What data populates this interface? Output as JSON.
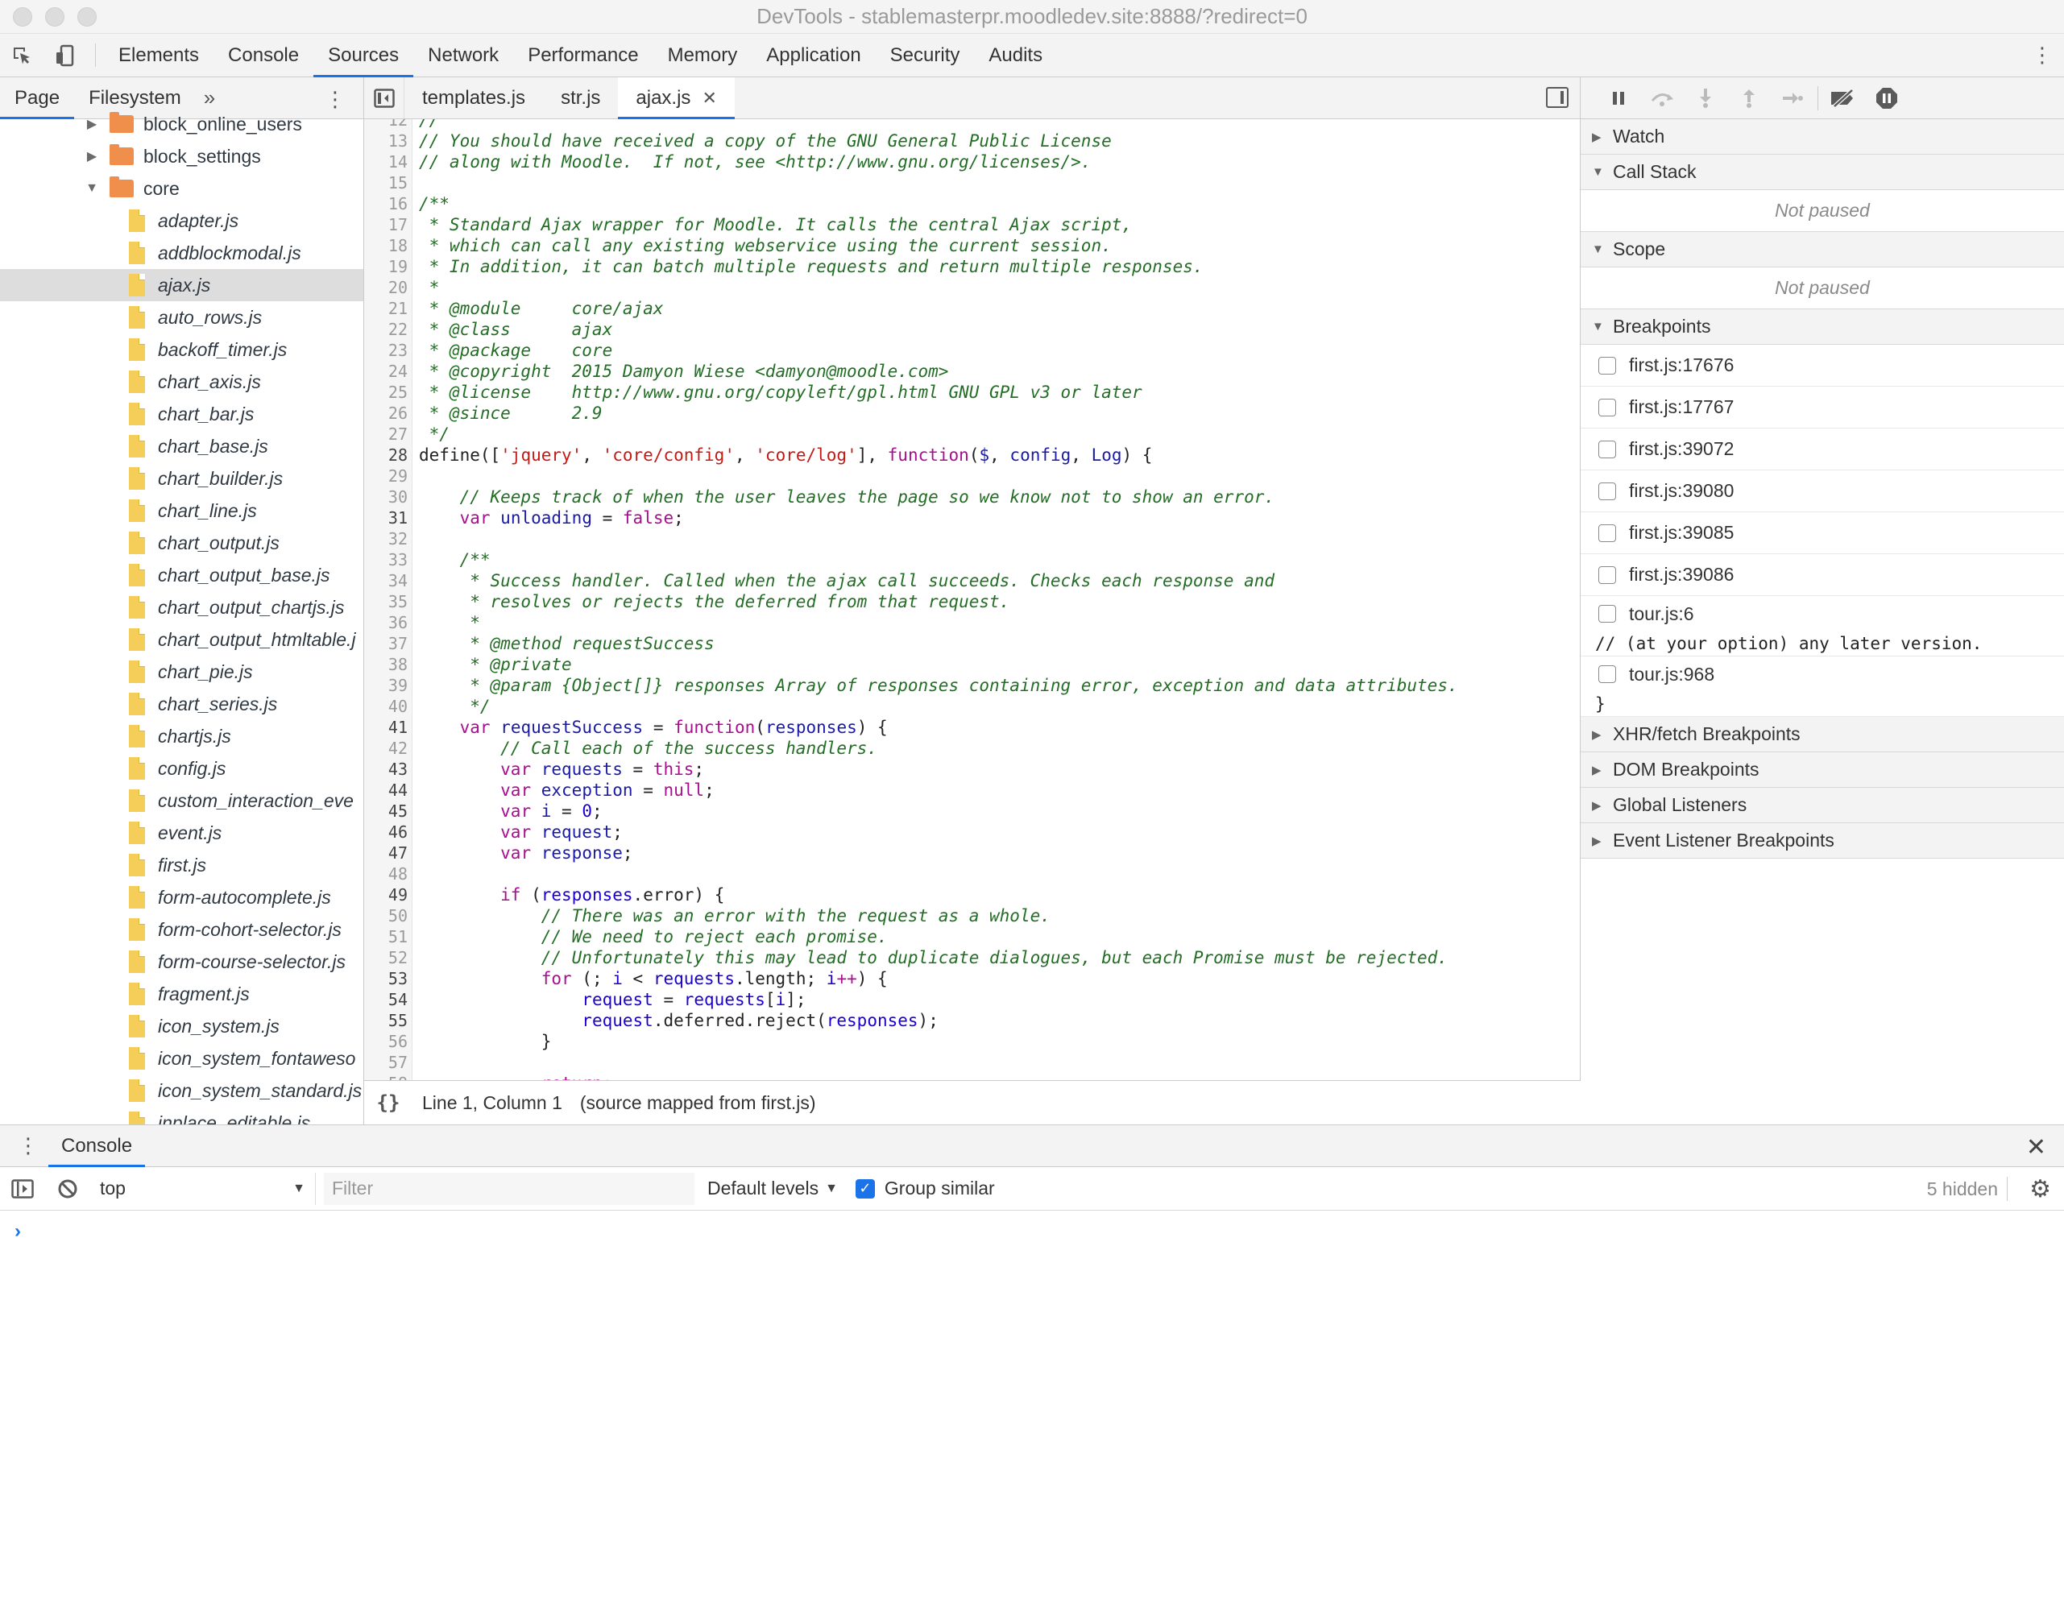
{
  "window": {
    "title": "DevTools - stablemasterpr.moodledev.site:8888/?redirect=0"
  },
  "main_tabs": [
    {
      "label": "Elements"
    },
    {
      "label": "Console"
    },
    {
      "label": "Sources"
    },
    {
      "label": "Network"
    },
    {
      "label": "Performance"
    },
    {
      "label": "Memory"
    },
    {
      "label": "Application"
    },
    {
      "label": "Security"
    },
    {
      "label": "Audits"
    }
  ],
  "active_main_tab": "Sources",
  "navigator": {
    "tabs": [
      {
        "label": "Page"
      },
      {
        "label": "Filesystem"
      }
    ],
    "more": "»",
    "tree": [
      {
        "label": "block_online_users",
        "type": "folder",
        "state": "collapsed",
        "level": 1
      },
      {
        "label": "block_settings",
        "type": "folder",
        "state": "collapsed",
        "level": 1
      },
      {
        "label": "core",
        "type": "folder",
        "state": "expanded",
        "level": 1
      },
      {
        "label": "adapter.js",
        "type": "file",
        "level": 2
      },
      {
        "label": "addblockmodal.js",
        "type": "file",
        "level": 2
      },
      {
        "label": "ajax.js",
        "type": "file",
        "level": 2,
        "selected": true
      },
      {
        "label": "auto_rows.js",
        "type": "file",
        "level": 2
      },
      {
        "label": "backoff_timer.js",
        "type": "file",
        "level": 2
      },
      {
        "label": "chart_axis.js",
        "type": "file",
        "level": 2
      },
      {
        "label": "chart_bar.js",
        "type": "file",
        "level": 2
      },
      {
        "label": "chart_base.js",
        "type": "file",
        "level": 2
      },
      {
        "label": "chart_builder.js",
        "type": "file",
        "level": 2
      },
      {
        "label": "chart_line.js",
        "type": "file",
        "level": 2
      },
      {
        "label": "chart_output.js",
        "type": "file",
        "level": 2
      },
      {
        "label": "chart_output_base.js",
        "type": "file",
        "level": 2
      },
      {
        "label": "chart_output_chartjs.js",
        "type": "file",
        "level": 2
      },
      {
        "label": "chart_output_htmltable.j",
        "type": "file",
        "level": 2
      },
      {
        "label": "chart_pie.js",
        "type": "file",
        "level": 2
      },
      {
        "label": "chart_series.js",
        "type": "file",
        "level": 2
      },
      {
        "label": "chartjs.js",
        "type": "file",
        "level": 2
      },
      {
        "label": "config.js",
        "type": "file",
        "level": 2
      },
      {
        "label": "custom_interaction_eve",
        "type": "file",
        "level": 2
      },
      {
        "label": "event.js",
        "type": "file",
        "level": 2
      },
      {
        "label": "first.js",
        "type": "file",
        "level": 2
      },
      {
        "label": "form-autocomplete.js",
        "type": "file",
        "level": 2
      },
      {
        "label": "form-cohort-selector.js",
        "type": "file",
        "level": 2
      },
      {
        "label": "form-course-selector.js",
        "type": "file",
        "level": 2
      },
      {
        "label": "fragment.js",
        "type": "file",
        "level": 2
      },
      {
        "label": "icon_system.js",
        "type": "file",
        "level": 2
      },
      {
        "label": "icon_system_fontaweso",
        "type": "file",
        "level": 2
      },
      {
        "label": "icon_system_standard.js",
        "type": "file",
        "level": 2
      },
      {
        "label": "inplace_editable.js",
        "type": "file",
        "level": 2
      }
    ]
  },
  "editor": {
    "tabs": [
      {
        "label": "templates.js",
        "active": false
      },
      {
        "label": "str.js",
        "active": false
      },
      {
        "label": "ajax.js",
        "active": true,
        "closable": true
      }
    ],
    "lines": [
      {
        "n": "12",
        "t": [
          [
            "c-comment",
            "//"
          ]
        ]
      },
      {
        "n": "13",
        "t": [
          [
            "c-comment",
            "// You should have received a copy of the GNU General Public License"
          ]
        ]
      },
      {
        "n": "14",
        "t": [
          [
            "c-comment",
            "// along with Moodle.  If not, see <http://www.gnu.org/licenses/>."
          ]
        ]
      },
      {
        "n": "15",
        "t": []
      },
      {
        "n": "16",
        "t": [
          [
            "c-comment",
            "/**"
          ]
        ]
      },
      {
        "n": "17",
        "t": [
          [
            "c-comment",
            " * Standard Ajax wrapper for Moodle. It calls the central Ajax script,"
          ]
        ]
      },
      {
        "n": "18",
        "t": [
          [
            "c-comment",
            " * which can call any existing webservice using the current session."
          ]
        ]
      },
      {
        "n": "19",
        "t": [
          [
            "c-comment",
            " * In addition, it can batch multiple requests and return multiple responses."
          ]
        ]
      },
      {
        "n": "20",
        "t": [
          [
            "c-comment",
            " *"
          ]
        ]
      },
      {
        "n": "21",
        "t": [
          [
            "c-comment",
            " * @module     core/ajax"
          ]
        ]
      },
      {
        "n": "22",
        "t": [
          [
            "c-comment",
            " * @class      ajax"
          ]
        ]
      },
      {
        "n": "23",
        "t": [
          [
            "c-comment",
            " * @package    core"
          ]
        ]
      },
      {
        "n": "24",
        "t": [
          [
            "c-comment",
            " * @copyright  2015 Damyon Wiese <damyon@moodle.com>"
          ]
        ]
      },
      {
        "n": "25",
        "t": [
          [
            "c-comment",
            " * @license    http://www.gnu.org/copyleft/gpl.html GNU GPL v3 or later"
          ]
        ]
      },
      {
        "n": "26",
        "t": [
          [
            "c-comment",
            " * @since      2.9"
          ]
        ]
      },
      {
        "n": "27",
        "t": [
          [
            "c-comment",
            " */"
          ]
        ]
      },
      {
        "n": "28",
        "bp": true,
        "t": [
          [
            "",
            "define(["
          ],
          [
            "c-str",
            "'jquery'"
          ],
          [
            "",
            ", "
          ],
          [
            "c-str",
            "'core/config'"
          ],
          [
            "",
            ", "
          ],
          [
            "c-str",
            "'core/log'"
          ],
          [
            "",
            "], "
          ],
          [
            "c-kw",
            "function"
          ],
          [
            "",
            "("
          ],
          [
            "c-def",
            "$"
          ],
          [
            "",
            ", "
          ],
          [
            "c-def",
            "config"
          ],
          [
            "",
            ", "
          ],
          [
            "c-def",
            "Log"
          ],
          [
            "",
            ") {"
          ]
        ]
      },
      {
        "n": "29",
        "t": []
      },
      {
        "n": "30",
        "t": [
          [
            "",
            "    "
          ],
          [
            "c-comment",
            "// Keeps track of when the user leaves the page so we know not to show an error."
          ]
        ]
      },
      {
        "n": "31",
        "bp": true,
        "t": [
          [
            "",
            "    "
          ],
          [
            "c-kw",
            "var"
          ],
          [
            "",
            " "
          ],
          [
            "c-def",
            "unloading"
          ],
          [
            "",
            " = "
          ],
          [
            "c-kw",
            "false"
          ],
          [
            "",
            ";"
          ]
        ]
      },
      {
        "n": "32",
        "t": []
      },
      {
        "n": "33",
        "t": [
          [
            "",
            "    "
          ],
          [
            "c-comment",
            "/**"
          ]
        ]
      },
      {
        "n": "34",
        "t": [
          [
            "",
            "    "
          ],
          [
            "c-comment",
            " * Success handler. Called when the ajax call succeeds. Checks each response and"
          ]
        ]
      },
      {
        "n": "35",
        "t": [
          [
            "",
            "    "
          ],
          [
            "c-comment",
            " * resolves or rejects the deferred from that request."
          ]
        ]
      },
      {
        "n": "36",
        "t": [
          [
            "",
            "    "
          ],
          [
            "c-comment",
            " *"
          ]
        ]
      },
      {
        "n": "37",
        "t": [
          [
            "",
            "    "
          ],
          [
            "c-comment",
            " * @method requestSuccess"
          ]
        ]
      },
      {
        "n": "38",
        "t": [
          [
            "",
            "    "
          ],
          [
            "c-comment",
            " * @private"
          ]
        ]
      },
      {
        "n": "39",
        "t": [
          [
            "",
            "    "
          ],
          [
            "c-comment",
            " * @param {Object[]} responses Array of responses containing error, exception and data attributes."
          ]
        ]
      },
      {
        "n": "40",
        "t": [
          [
            "",
            "    "
          ],
          [
            "c-comment",
            " */"
          ]
        ]
      },
      {
        "n": "41",
        "bp": true,
        "t": [
          [
            "",
            "    "
          ],
          [
            "c-kw",
            "var"
          ],
          [
            "",
            " "
          ],
          [
            "c-def",
            "requestSuccess"
          ],
          [
            "",
            " = "
          ],
          [
            "c-kw",
            "function"
          ],
          [
            "",
            "("
          ],
          [
            "c-def",
            "responses"
          ],
          [
            "",
            ") {"
          ]
        ]
      },
      {
        "n": "42",
        "t": [
          [
            "",
            "        "
          ],
          [
            "c-comment",
            "// Call each of the success handlers."
          ]
        ]
      },
      {
        "n": "43",
        "bp": true,
        "t": [
          [
            "",
            "        "
          ],
          [
            "c-kw",
            "var"
          ],
          [
            "",
            " "
          ],
          [
            "c-def",
            "requests"
          ],
          [
            "",
            " = "
          ],
          [
            "c-kw",
            "this"
          ],
          [
            "",
            ";"
          ]
        ]
      },
      {
        "n": "44",
        "bp": true,
        "t": [
          [
            "",
            "        "
          ],
          [
            "c-kw",
            "var"
          ],
          [
            "",
            " "
          ],
          [
            "c-def",
            "exception"
          ],
          [
            "",
            " = "
          ],
          [
            "c-kw",
            "null"
          ],
          [
            "",
            ";"
          ]
        ]
      },
      {
        "n": "45",
        "bp": true,
        "t": [
          [
            "",
            "        "
          ],
          [
            "c-kw",
            "var"
          ],
          [
            "",
            " "
          ],
          [
            "c-def",
            "i"
          ],
          [
            "",
            " = "
          ],
          [
            "c-num",
            "0"
          ],
          [
            "",
            ";"
          ]
        ]
      },
      {
        "n": "46",
        "bp": true,
        "t": [
          [
            "",
            "        "
          ],
          [
            "c-kw",
            "var"
          ],
          [
            "",
            " "
          ],
          [
            "c-def",
            "request"
          ],
          [
            "",
            ";"
          ]
        ]
      },
      {
        "n": "47",
        "bp": true,
        "t": [
          [
            "",
            "        "
          ],
          [
            "c-kw",
            "var"
          ],
          [
            "",
            " "
          ],
          [
            "c-def",
            "response"
          ],
          [
            "",
            ";"
          ]
        ]
      },
      {
        "n": "48",
        "t": []
      },
      {
        "n": "49",
        "bp": true,
        "t": [
          [
            "",
            "        "
          ],
          [
            "c-kw",
            "if"
          ],
          [
            "",
            " ("
          ],
          [
            "c-var",
            "responses"
          ],
          [
            "",
            ".error) {"
          ]
        ]
      },
      {
        "n": "50",
        "t": [
          [
            "",
            "            "
          ],
          [
            "c-comment",
            "// There was an error with the request as a whole."
          ]
        ]
      },
      {
        "n": "51",
        "t": [
          [
            "",
            "            "
          ],
          [
            "c-comment",
            "// We need to reject each promise."
          ]
        ]
      },
      {
        "n": "52",
        "t": [
          [
            "",
            "            "
          ],
          [
            "c-comment",
            "// Unfortunately this may lead to duplicate dialogues, but each Promise must be rejected."
          ]
        ]
      },
      {
        "n": "53",
        "bp": true,
        "t": [
          [
            "",
            "            "
          ],
          [
            "c-kw",
            "for"
          ],
          [
            "",
            " (; "
          ],
          [
            "c-var",
            "i"
          ],
          [
            "",
            " < "
          ],
          [
            "c-var",
            "requests"
          ],
          [
            "",
            ".length; "
          ],
          [
            "c-var",
            "i"
          ],
          [
            "c-kw",
            "++"
          ],
          [
            "",
            ") {"
          ]
        ]
      },
      {
        "n": "54",
        "bp": true,
        "t": [
          [
            "",
            "                "
          ],
          [
            "c-var",
            "request"
          ],
          [
            "",
            " = "
          ],
          [
            "c-var",
            "requests"
          ],
          [
            "",
            "["
          ],
          [
            "c-var",
            "i"
          ],
          [
            "",
            "];"
          ]
        ]
      },
      {
        "n": "55",
        "bp": true,
        "t": [
          [
            "",
            "                "
          ],
          [
            "c-var",
            "request"
          ],
          [
            "",
            ".deferred.reject("
          ],
          [
            "c-var",
            "responses"
          ],
          [
            "",
            ");"
          ]
        ]
      },
      {
        "n": "56",
        "t": [
          [
            "",
            "            }"
          ]
        ]
      },
      {
        "n": "57",
        "t": []
      },
      {
        "n": "58",
        "t": [
          [
            "",
            "            "
          ],
          [
            "c-kw",
            "return"
          ],
          [
            "",
            ";"
          ]
        ]
      }
    ],
    "status": {
      "braces": "{}",
      "position": "Line 1, Column 1",
      "source": "(source mapped from first.js)"
    }
  },
  "debugger": {
    "watch": "Watch",
    "call_stack": "Call Stack",
    "call_stack_status": "Not paused",
    "scope": "Scope",
    "scope_status": "Not paused",
    "breakpoints_title": "Breakpoints",
    "breakpoints": [
      {
        "label": "first.js:17676"
      },
      {
        "label": "first.js:17767"
      },
      {
        "label": "first.js:39072"
      },
      {
        "label": "first.js:39080"
      },
      {
        "label": "first.js:39085"
      },
      {
        "label": "first.js:39086"
      },
      {
        "label": "tour.js:6",
        "code": "// (at your option) any later version."
      },
      {
        "label": "tour.js:968",
        "code": "}"
      }
    ],
    "sections": [
      {
        "label": "XHR/fetch Breakpoints"
      },
      {
        "label": "DOM Breakpoints"
      },
      {
        "label": "Global Listeners"
      },
      {
        "label": "Event Listener Breakpoints"
      }
    ]
  },
  "drawer": {
    "tab": "Console",
    "context": "top",
    "filter_placeholder": "Filter",
    "levels": "Default levels",
    "group_similar": "Group similar",
    "hidden": "5 hidden",
    "prompt": "›"
  }
}
